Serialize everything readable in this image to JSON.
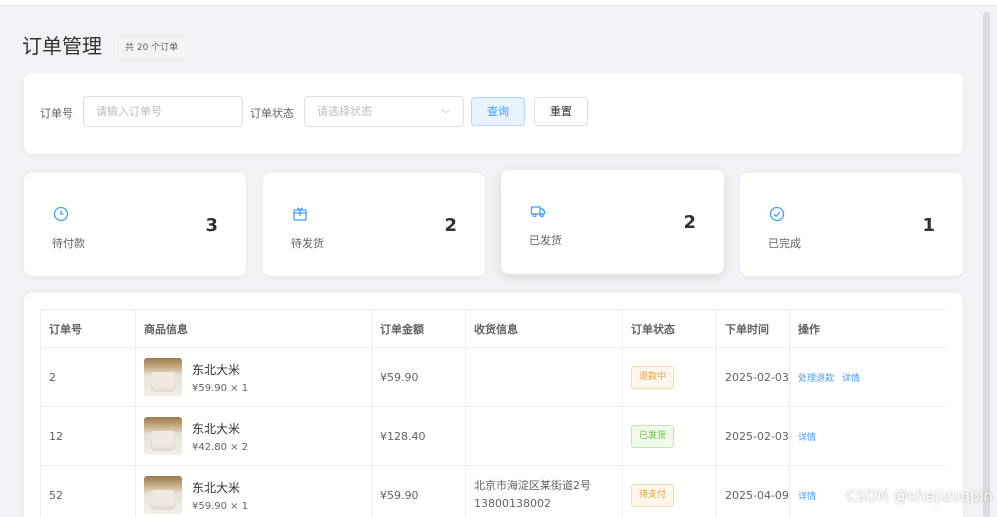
{
  "page": {
    "title": "订单管理",
    "count_badge": "共 20 个订单"
  },
  "search": {
    "order_no_label": "订单号",
    "order_no_placeholder": "请输入订单号",
    "status_label": "订单状态",
    "status_placeholder": "请选择状态",
    "query_label": "查询",
    "reset_label": "重置"
  },
  "stats": [
    {
      "label": "待付款",
      "value": "3",
      "icon": "clock-icon"
    },
    {
      "label": "待发货",
      "value": "2",
      "icon": "package-icon"
    },
    {
      "label": "已发货",
      "value": "2",
      "icon": "truck-icon"
    },
    {
      "label": "已完成",
      "value": "1",
      "icon": "check-circle-icon"
    }
  ],
  "table": {
    "columns": [
      "订单号",
      "商品信息",
      "订单金额",
      "收货信息",
      "订单状态",
      "下单时间",
      "操作"
    ],
    "rows": [
      {
        "order_no": "2",
        "product": "东北大米",
        "price_qty": "¥59.90 × 1",
        "amount": "¥59.90",
        "address": "",
        "phone": "",
        "status": "退款中",
        "date": "2025-02-03",
        "actions": [
          "处理退款",
          "详情"
        ]
      },
      {
        "order_no": "12",
        "product": "东北大米",
        "price_qty": "¥42.80 × 2",
        "amount": "¥128.40",
        "address": "",
        "phone": "",
        "status": "已发货",
        "date": "2025-02-03",
        "actions": [
          "详情"
        ]
      },
      {
        "order_no": "52",
        "product": "东北大米",
        "price_qty": "¥59.90 × 1",
        "amount": "¥59.90",
        "address": "北京市海淀区某街道2号",
        "phone": "13800138002",
        "status": "待支付",
        "date": "2025-04-09",
        "actions": [
          "详情"
        ]
      }
    ]
  },
  "colors": {
    "accent": "#409eff",
    "warning": "#e6a23c",
    "success": "#67c23a"
  },
  "watermark": "CSDN @shejizuopin"
}
